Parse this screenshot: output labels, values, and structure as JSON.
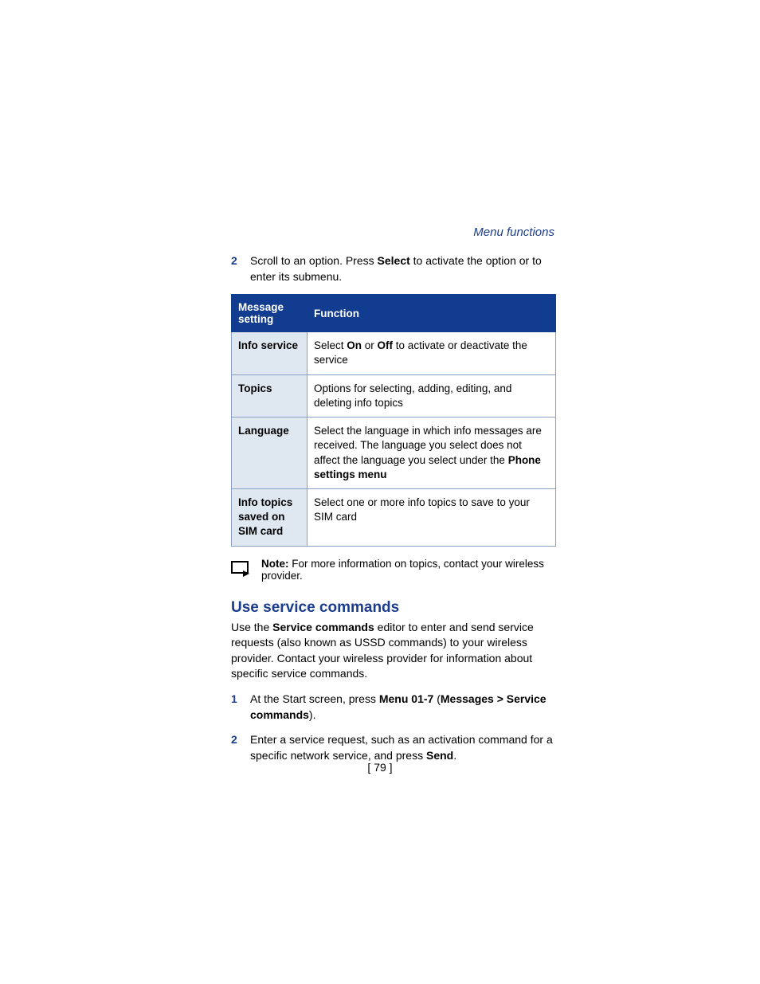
{
  "header": {
    "right": "Menu functions"
  },
  "step_top": {
    "num": "2",
    "prefix": "Scroll to an option. Press ",
    "bold": "Select",
    "suffix": " to activate the option or to enter its submenu."
  },
  "table": {
    "head_setting": "Message setting",
    "head_function": "Function",
    "rows": [
      {
        "setting": "Info service",
        "func_prefix": "Select ",
        "func_b1": "On",
        "func_mid": " or ",
        "func_b2": "Off",
        "func_suffix": " to activate or deactivate the service"
      },
      {
        "setting": "Topics",
        "func": "Options for selecting, adding, editing, and deleting info topics"
      },
      {
        "setting": "Language",
        "func_prefix": "Select the language in which info messages are received. The language you select does not affect the language you select under the ",
        "func_b1": "Phone settings menu",
        "func_suffix": ""
      },
      {
        "setting": "Info topics saved on SIM card",
        "func": "Select one or more info topics to save to your SIM card"
      }
    ]
  },
  "note": {
    "label": "Note:",
    "text": " For more information on topics, contact your wireless provider."
  },
  "section": {
    "title": "Use service commands",
    "para_prefix": "Use the ",
    "para_b1": "Service commands",
    "para_suffix": " editor to enter and send service requests (also known as USSD commands) to your wireless provider. Contact your wireless provider for information about specific service commands."
  },
  "step1": {
    "num": "1",
    "prefix": "At the Start screen, press ",
    "b1": "Menu 01-7",
    "mid": " (",
    "b2": "Messages > Service commands",
    "suffix": ")."
  },
  "step2": {
    "num": "2",
    "prefix": "Enter a service request, such as an activation command for a specific network service, and press ",
    "b1": "Send",
    "suffix": "."
  },
  "footer": {
    "page": "[ 79 ]"
  }
}
